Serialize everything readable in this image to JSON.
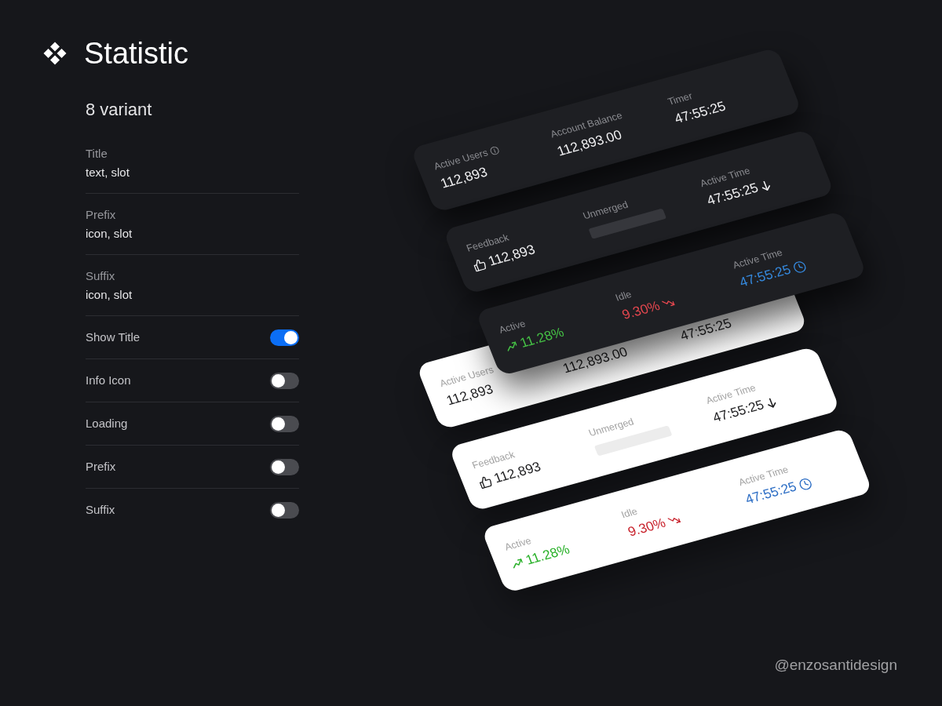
{
  "header": {
    "title": "Statistic"
  },
  "variants": "8 variant",
  "properties": [
    {
      "label": "Title",
      "value": "text, slot"
    },
    {
      "label": "Prefix",
      "value": "icon, slot"
    },
    {
      "label": "Suffix",
      "value": "icon, slot"
    }
  ],
  "toggles": [
    {
      "label": "Show Title",
      "on": true
    },
    {
      "label": "Info Icon",
      "on": false
    },
    {
      "label": "Loading",
      "on": false
    },
    {
      "label": "Prefix",
      "on": false
    },
    {
      "label": "Suffix",
      "on": false
    }
  ],
  "stacks": [
    {
      "kind": "dark",
      "cards": [
        {
          "stats": [
            {
              "kind": "info",
              "label": "Active Users",
              "value": "112,893"
            },
            {
              "kind": "plain",
              "label": "Account Balance",
              "value": "112,893.00"
            },
            {
              "kind": "plain",
              "label": "Timer",
              "value": "47:55:25"
            }
          ]
        },
        {
          "stats": [
            {
              "kind": "like",
              "label": "Feedback",
              "value": "112,893"
            },
            {
              "kind": "loading",
              "label": "Unmerged"
            },
            {
              "kind": "down",
              "label": "Active Time",
              "value": "47:55:25"
            }
          ]
        },
        {
          "stats": [
            {
              "kind": "rise",
              "label": "Active",
              "value": "11.28%"
            },
            {
              "kind": "fall",
              "label": "Idle",
              "value": "9.30%"
            },
            {
              "kind": "timer",
              "label": "Active Time",
              "value": "47:55:25"
            }
          ]
        }
      ]
    },
    {
      "kind": "light",
      "cards": [
        {
          "stats": [
            {
              "kind": "plain",
              "label": "Active Users",
              "value": "112,893"
            },
            {
              "kind": "plain",
              "value": "112,893.00"
            },
            {
              "kind": "plain",
              "value": "47:55:25"
            }
          ]
        },
        {
          "stats": [
            {
              "kind": "like",
              "label": "Feedback",
              "value": "112,893"
            },
            {
              "kind": "loading",
              "label": "Unmerged"
            },
            {
              "kind": "down",
              "label": "Active Time",
              "value": "47:55:25"
            }
          ]
        },
        {
          "stats": [
            {
              "kind": "rise",
              "label": "Active",
              "value": "11.28%"
            },
            {
              "kind": "fall",
              "label": "Idle",
              "value": "9.30%"
            },
            {
              "kind": "timer",
              "label": "Active Time",
              "value": "47:55:25"
            }
          ]
        }
      ]
    }
  ],
  "credit": "@enzosantidesign"
}
